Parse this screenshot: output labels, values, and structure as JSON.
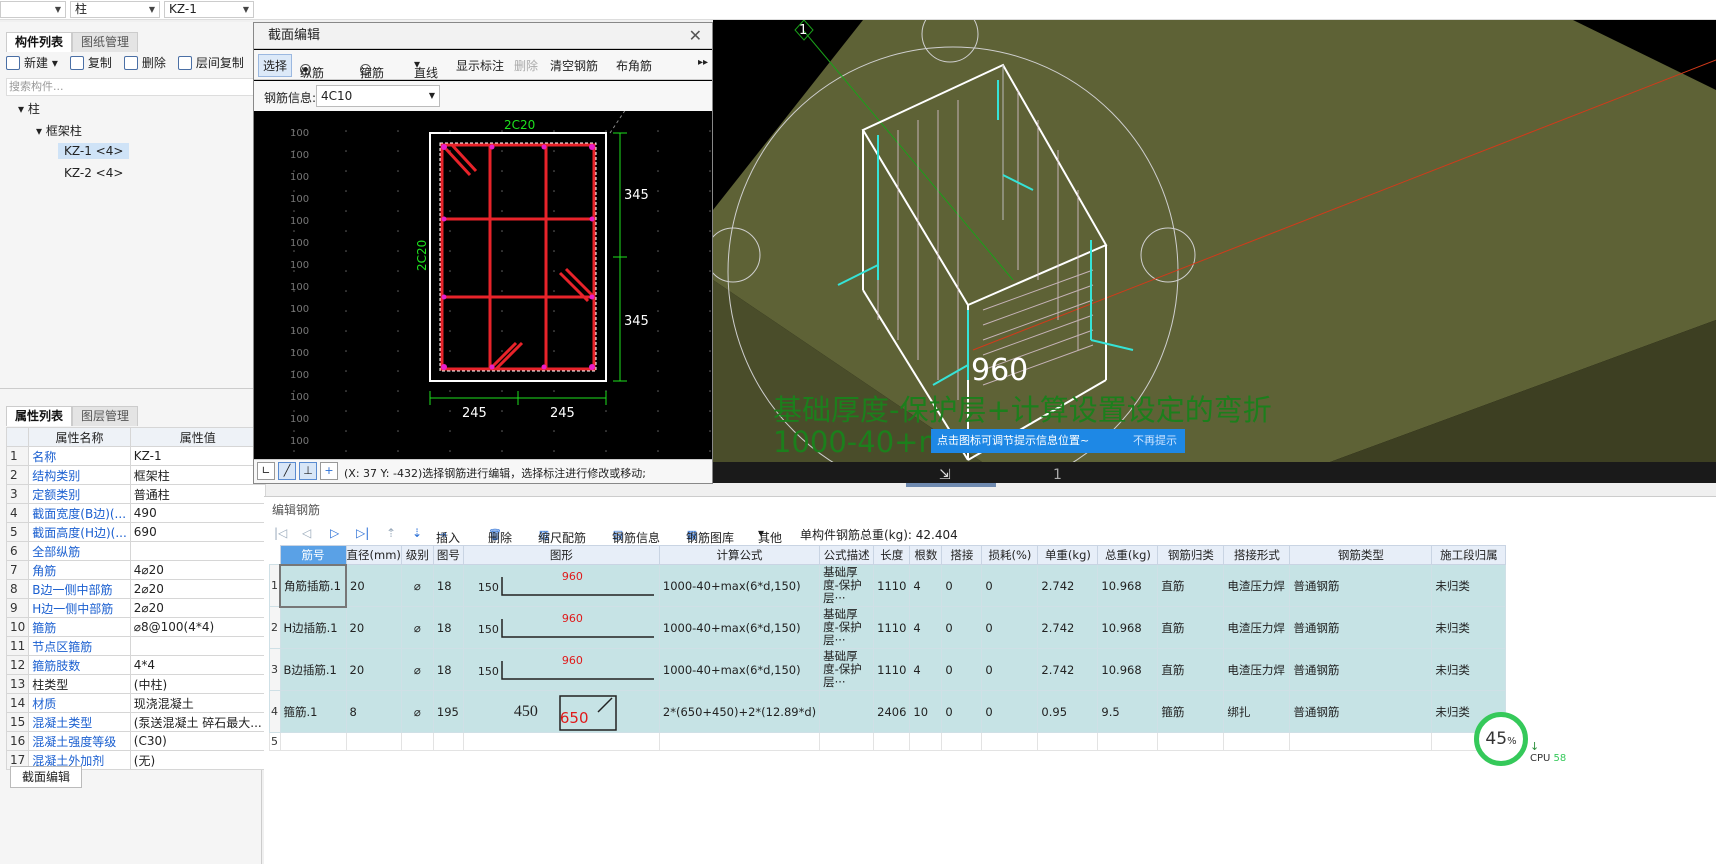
{
  "topbar": {
    "combo1": "",
    "combo2": "柱",
    "combo3": "KZ-1"
  },
  "left": {
    "tabs": [
      "构件列表",
      "图纸管理"
    ],
    "tools": [
      "新建",
      "复制",
      "删除",
      "层间复制"
    ],
    "search_placeholder": "搜索构件...",
    "tree": {
      "root": "柱",
      "group": "框架柱",
      "items": [
        "KZ-1 <4>",
        "KZ-2 <4>"
      ]
    },
    "prop_tabs": [
      "属性列表",
      "图层管理"
    ],
    "prop_headers": [
      "属性名称",
      "属性值"
    ],
    "props": [
      {
        "n": "1",
        "name": "名称",
        "val": "KZ-1",
        "blue": true
      },
      {
        "n": "2",
        "name": "结构类别",
        "val": "框架柱",
        "blue": true
      },
      {
        "n": "3",
        "name": "定额类别",
        "val": "普通柱",
        "blue": true
      },
      {
        "n": "4",
        "name": "截面宽度(B边)(...",
        "val": "490",
        "blue": true
      },
      {
        "n": "5",
        "name": "截面高度(H边)(...",
        "val": "690",
        "blue": true
      },
      {
        "n": "6",
        "name": "全部纵筋",
        "val": "",
        "blue": true
      },
      {
        "n": "7",
        "name": "角筋",
        "val": "4⌀20",
        "blue": true
      },
      {
        "n": "8",
        "name": "B边一侧中部筋",
        "val": "2⌀20",
        "blue": true
      },
      {
        "n": "9",
        "name": "H边一侧中部筋",
        "val": "2⌀20",
        "blue": true
      },
      {
        "n": "10",
        "name": "箍筋",
        "val": "⌀8@100(4*4)",
        "blue": true
      },
      {
        "n": "11",
        "name": "节点区箍筋",
        "val": "",
        "blue": true
      },
      {
        "n": "12",
        "name": "箍筋肢数",
        "val": "4*4",
        "blue": true
      },
      {
        "n": "13",
        "name": "柱类型",
        "val": "(中柱)",
        "blue": false
      },
      {
        "n": "14",
        "name": "材质",
        "val": "现浇混凝土",
        "blue": true
      },
      {
        "n": "15",
        "name": "混凝土类型",
        "val": "(泵送混凝土 碎石最大...",
        "blue": true
      },
      {
        "n": "16",
        "name": "混凝土强度等级",
        "val": "(C30)",
        "blue": true
      },
      {
        "n": "17",
        "name": "混凝土外加剂",
        "val": "(无)",
        "blue": true
      }
    ],
    "bottom_button": "截面编辑"
  },
  "section": {
    "title": "截面编辑",
    "tools": {
      "select": "选择",
      "long": "纵筋",
      "stirrup": "箍筋",
      "line": "直线",
      "show_dim": "显示标注",
      "delete": "删除",
      "clear": "清空钢筋",
      "corner": "布角筋"
    },
    "info_label": "钢筋信息:",
    "info_value": "4C10",
    "labels": {
      "top": "2C20",
      "left": "2C20",
      "d1": "345",
      "d2": "345",
      "b1": "245",
      "b2": "245"
    },
    "grid_label": "100",
    "status": "(X: 37 Y: -432)选择钢筋进行编辑，选择标注进行修改或移动;"
  },
  "view3d": {
    "axis": "1",
    "axis2": "1",
    "dim": "960",
    "formula_line1": "基础厚度-保护层+计算设置设定的弯折",
    "formula_line2": "1000-40+m",
    "tip": "点击图标可调节提示信息位置~",
    "tip_dismiss": "不再提示"
  },
  "rebar": {
    "title": "编辑钢筋",
    "tools": [
      "插入",
      "删除",
      "缩尺配筋",
      "钢筋信息",
      "钢筋图库",
      "其他"
    ],
    "total": "单构件钢筋总重(kg): 42.404",
    "headers": [
      "筋号",
      "直径(mm)",
      "级别",
      "图号",
      "图形",
      "计算公式",
      "公式描述",
      "长度",
      "根数",
      "搭接",
      "损耗(%)",
      "单重(kg)",
      "总重(kg)",
      "钢筋归类",
      "搭接形式",
      "钢筋类型",
      "施工段归属"
    ],
    "rows": [
      {
        "idx": "1",
        "name": "角筋插筋.1",
        "dia": "20",
        "grade": "⌀",
        "fig": "18",
        "s1": "150",
        "s2": "960",
        "formula": "1000-40+max(6*d,150)",
        "desc": "基础厚度-保护层···",
        "len": "1110",
        "count": "4",
        "lap": "0",
        "loss": "0",
        "unit": "2.742",
        "total": "10.968",
        "cat": "直筋",
        "lapform": "电渣压力焊",
        "type": "普通钢筋",
        "stage": "未归类"
      },
      {
        "idx": "2",
        "name": "H边插筋.1",
        "dia": "20",
        "grade": "⌀",
        "fig": "18",
        "s1": "150",
        "s2": "960",
        "formula": "1000-40+max(6*d,150)",
        "desc": "基础厚度-保护层···",
        "len": "1110",
        "count": "4",
        "lap": "0",
        "loss": "0",
        "unit": "2.742",
        "total": "10.968",
        "cat": "直筋",
        "lapform": "电渣压力焊",
        "type": "普通钢筋",
        "stage": "未归类"
      },
      {
        "idx": "3",
        "name": "B边插筋.1",
        "dia": "20",
        "grade": "⌀",
        "fig": "18",
        "s1": "150",
        "s2": "960",
        "formula": "1000-40+max(6*d,150)",
        "desc": "基础厚度-保护层···",
        "len": "1110",
        "count": "4",
        "lap": "0",
        "loss": "0",
        "unit": "2.742",
        "total": "10.968",
        "cat": "直筋",
        "lapform": "电渣压力焊",
        "type": "普通钢筋",
        "stage": "未归类"
      },
      {
        "idx": "4",
        "name": "箍筋.1",
        "dia": "8",
        "grade": "⌀",
        "fig": "195",
        "s1": "450",
        "s2": "650",
        "formula": "2*(650+450)+2*(12.89*d)",
        "desc": "",
        "len": "2406",
        "count": "10",
        "lap": "0",
        "loss": "0",
        "unit": "0.95",
        "total": "9.5",
        "cat": "箍筋",
        "lapform": "绑扎",
        "type": "普通钢筋",
        "stage": "未归类"
      }
    ],
    "empty_idx": "5"
  },
  "cpu": {
    "percent": "45",
    "label": "CPU",
    "val": "58"
  }
}
